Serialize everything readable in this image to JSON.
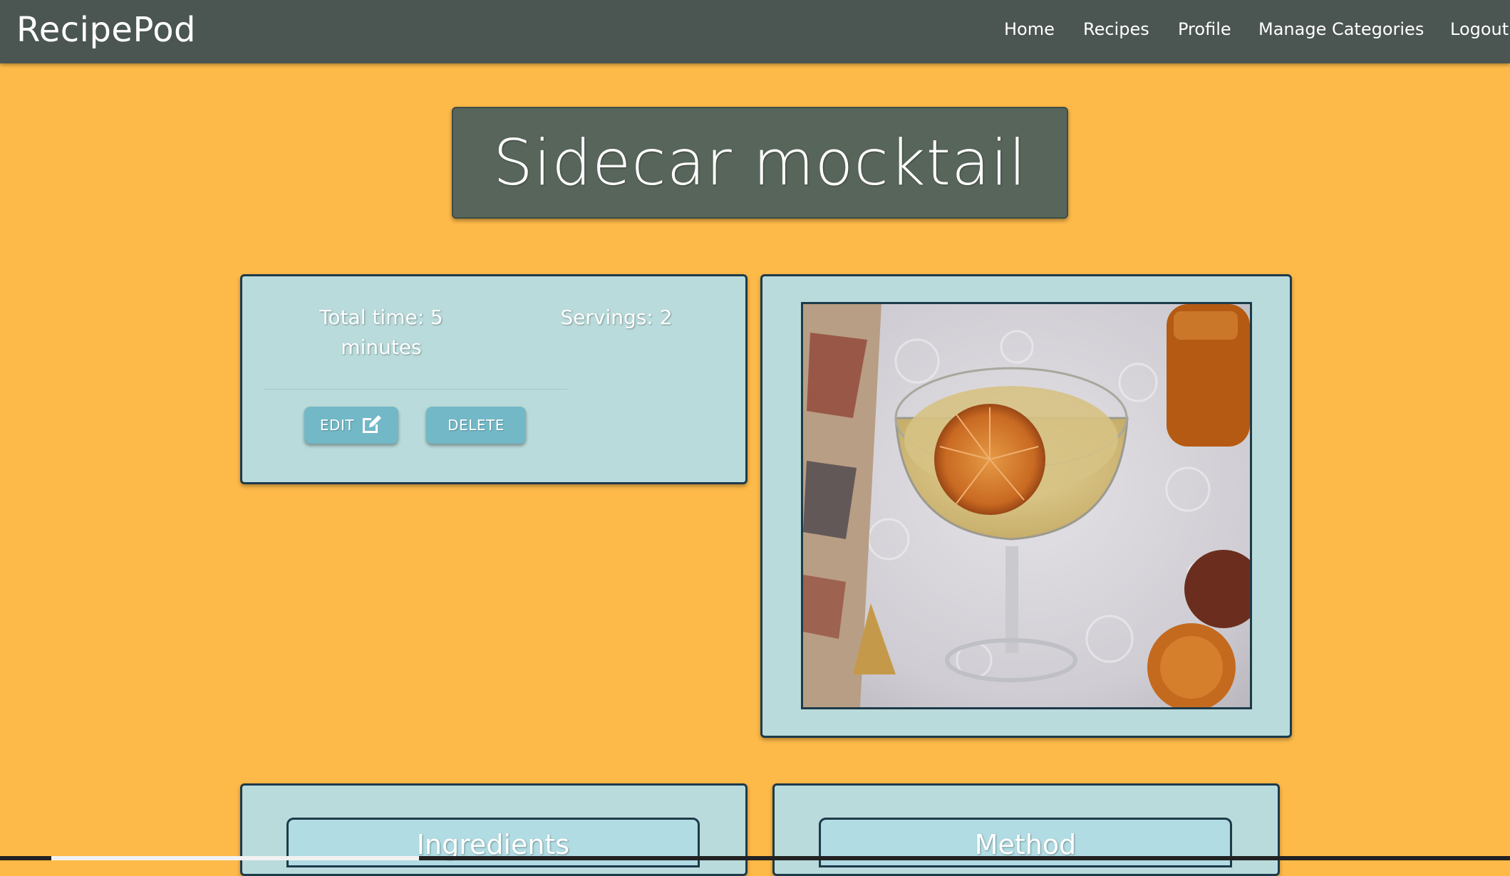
{
  "navbar": {
    "brand": "RecipePod",
    "links": [
      "Home",
      "Recipes",
      "Profile",
      "Manage Categories",
      "Logout"
    ]
  },
  "recipe": {
    "title": "Sidecar mocktail",
    "total_time": "Total time: 5 minutes",
    "servings": "Servings: 2",
    "edit_label": "EDIT",
    "delete_label": "DELETE",
    "ingredients_heading": "Ingredients",
    "method_heading": "Method"
  },
  "colors": {
    "page_background": "#FEBA49",
    "navbar": "#4B5551",
    "title_card": "#58655A",
    "panel": "#BADBDB",
    "button": "#72B8C6",
    "border": "#1D3A4A"
  },
  "icons": {
    "edit": "edit-icon"
  }
}
